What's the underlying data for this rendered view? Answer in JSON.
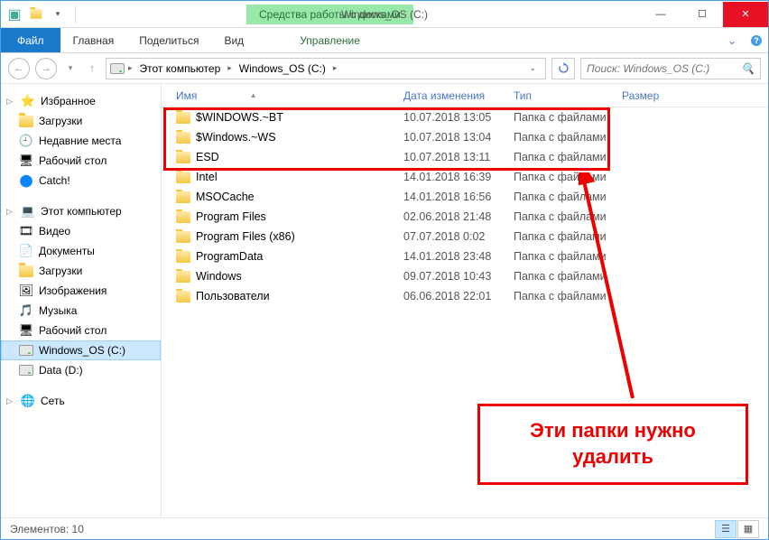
{
  "titlebar": {
    "context_tab": "Средства работы с дисками",
    "title": "Windows_OS (C:)"
  },
  "ribbon": {
    "file": "Файл",
    "tabs": [
      "Главная",
      "Поделиться",
      "Вид"
    ],
    "context_tab": "Управление"
  },
  "address": {
    "crumbs": [
      "Этот компьютер",
      "Windows_OS (C:)"
    ],
    "search_placeholder": "Поиск: Windows_OS (C:)"
  },
  "sidebar": {
    "favorites": {
      "label": "Избранное",
      "items": [
        "Загрузки",
        "Недавние места",
        "Рабочий стол",
        "Catch!"
      ]
    },
    "computer": {
      "label": "Этот компьютер",
      "items": [
        "Видео",
        "Документы",
        "Загрузки",
        "Изображения",
        "Музыка",
        "Рабочий стол",
        "Windows_OS (C:)",
        "Data (D:)"
      ]
    },
    "network": {
      "label": "Сеть"
    }
  },
  "columns": {
    "name": "Имя",
    "date": "Дата изменения",
    "type": "Тип",
    "size": "Размер"
  },
  "rows": [
    {
      "name": "$WINDOWS.~BT",
      "date": "10.07.2018 13:05",
      "type": "Папка с файлами"
    },
    {
      "name": "$Windows.~WS",
      "date": "10.07.2018 13:04",
      "type": "Папка с файлами"
    },
    {
      "name": "ESD",
      "date": "10.07.2018 13:11",
      "type": "Папка с файлами"
    },
    {
      "name": "Intel",
      "date": "14.01.2018 16:39",
      "type": "Папка с файлами"
    },
    {
      "name": "MSOCache",
      "date": "14.01.2018 16:56",
      "type": "Папка с файлами"
    },
    {
      "name": "Program Files",
      "date": "02.06.2018 21:48",
      "type": "Папка с файлами"
    },
    {
      "name": "Program Files (x86)",
      "date": "07.07.2018 0:02",
      "type": "Папка с файлами"
    },
    {
      "name": "ProgramData",
      "date": "14.01.2018 23:48",
      "type": "Папка с файлами"
    },
    {
      "name": "Windows",
      "date": "09.07.2018 10:43",
      "type": "Папка с файлами"
    },
    {
      "name": "Пользователи",
      "date": "06.06.2018 22:01",
      "type": "Папка с файлами"
    }
  ],
  "annotation": "Эти папки нужно удалить",
  "status": {
    "count_label": "Элементов:",
    "count": "10"
  }
}
